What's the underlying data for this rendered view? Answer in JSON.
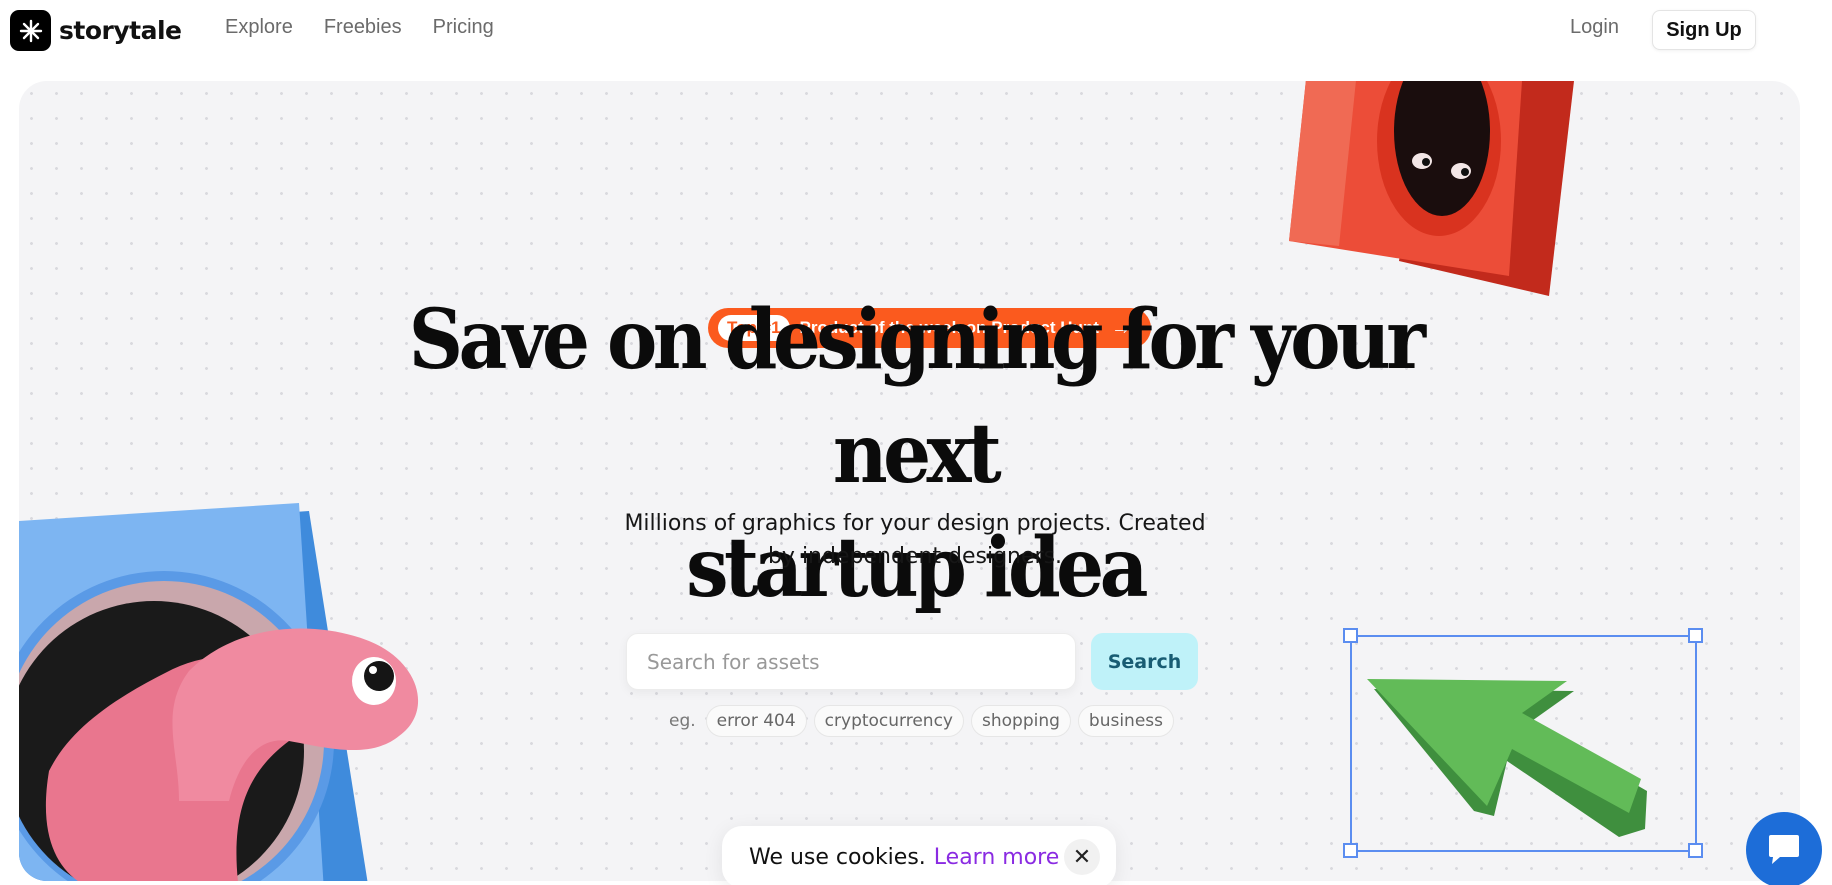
{
  "nav": {
    "brand": "storytale",
    "links": [
      "Explore",
      "Freebies",
      "Pricing"
    ],
    "login": "Login",
    "signup": "Sign Up"
  },
  "hero": {
    "badge_pill": "Top #1",
    "badge_text": "Product of the week on Product Hunt",
    "headline_line1": "Save on designing for your next",
    "headline_line2": "startup idea",
    "subhead_line1": "Millions of graphics for your design projects. Created",
    "subhead_line2": "by independent designers.",
    "search_placeholder": "Search for assets",
    "search_button": "Search",
    "examples_label": "eg.",
    "examples": [
      "error 404",
      "cryptocurrency",
      "shopping",
      "business"
    ]
  },
  "cookie": {
    "text": "We use cookies.",
    "link": "Learn more"
  },
  "icons": {
    "logo": "starburst-icon",
    "badge_arrow": "arrow-right-icon",
    "close": "close-icon",
    "chat": "chat-icon"
  },
  "colors": {
    "accent_orange": "#fb5a1e",
    "search_button_bg": "#bff2f9",
    "cookie_link": "#8a2be2",
    "chat_bubble": "#1d6dd8",
    "selection_frame": "#5b8df0"
  }
}
